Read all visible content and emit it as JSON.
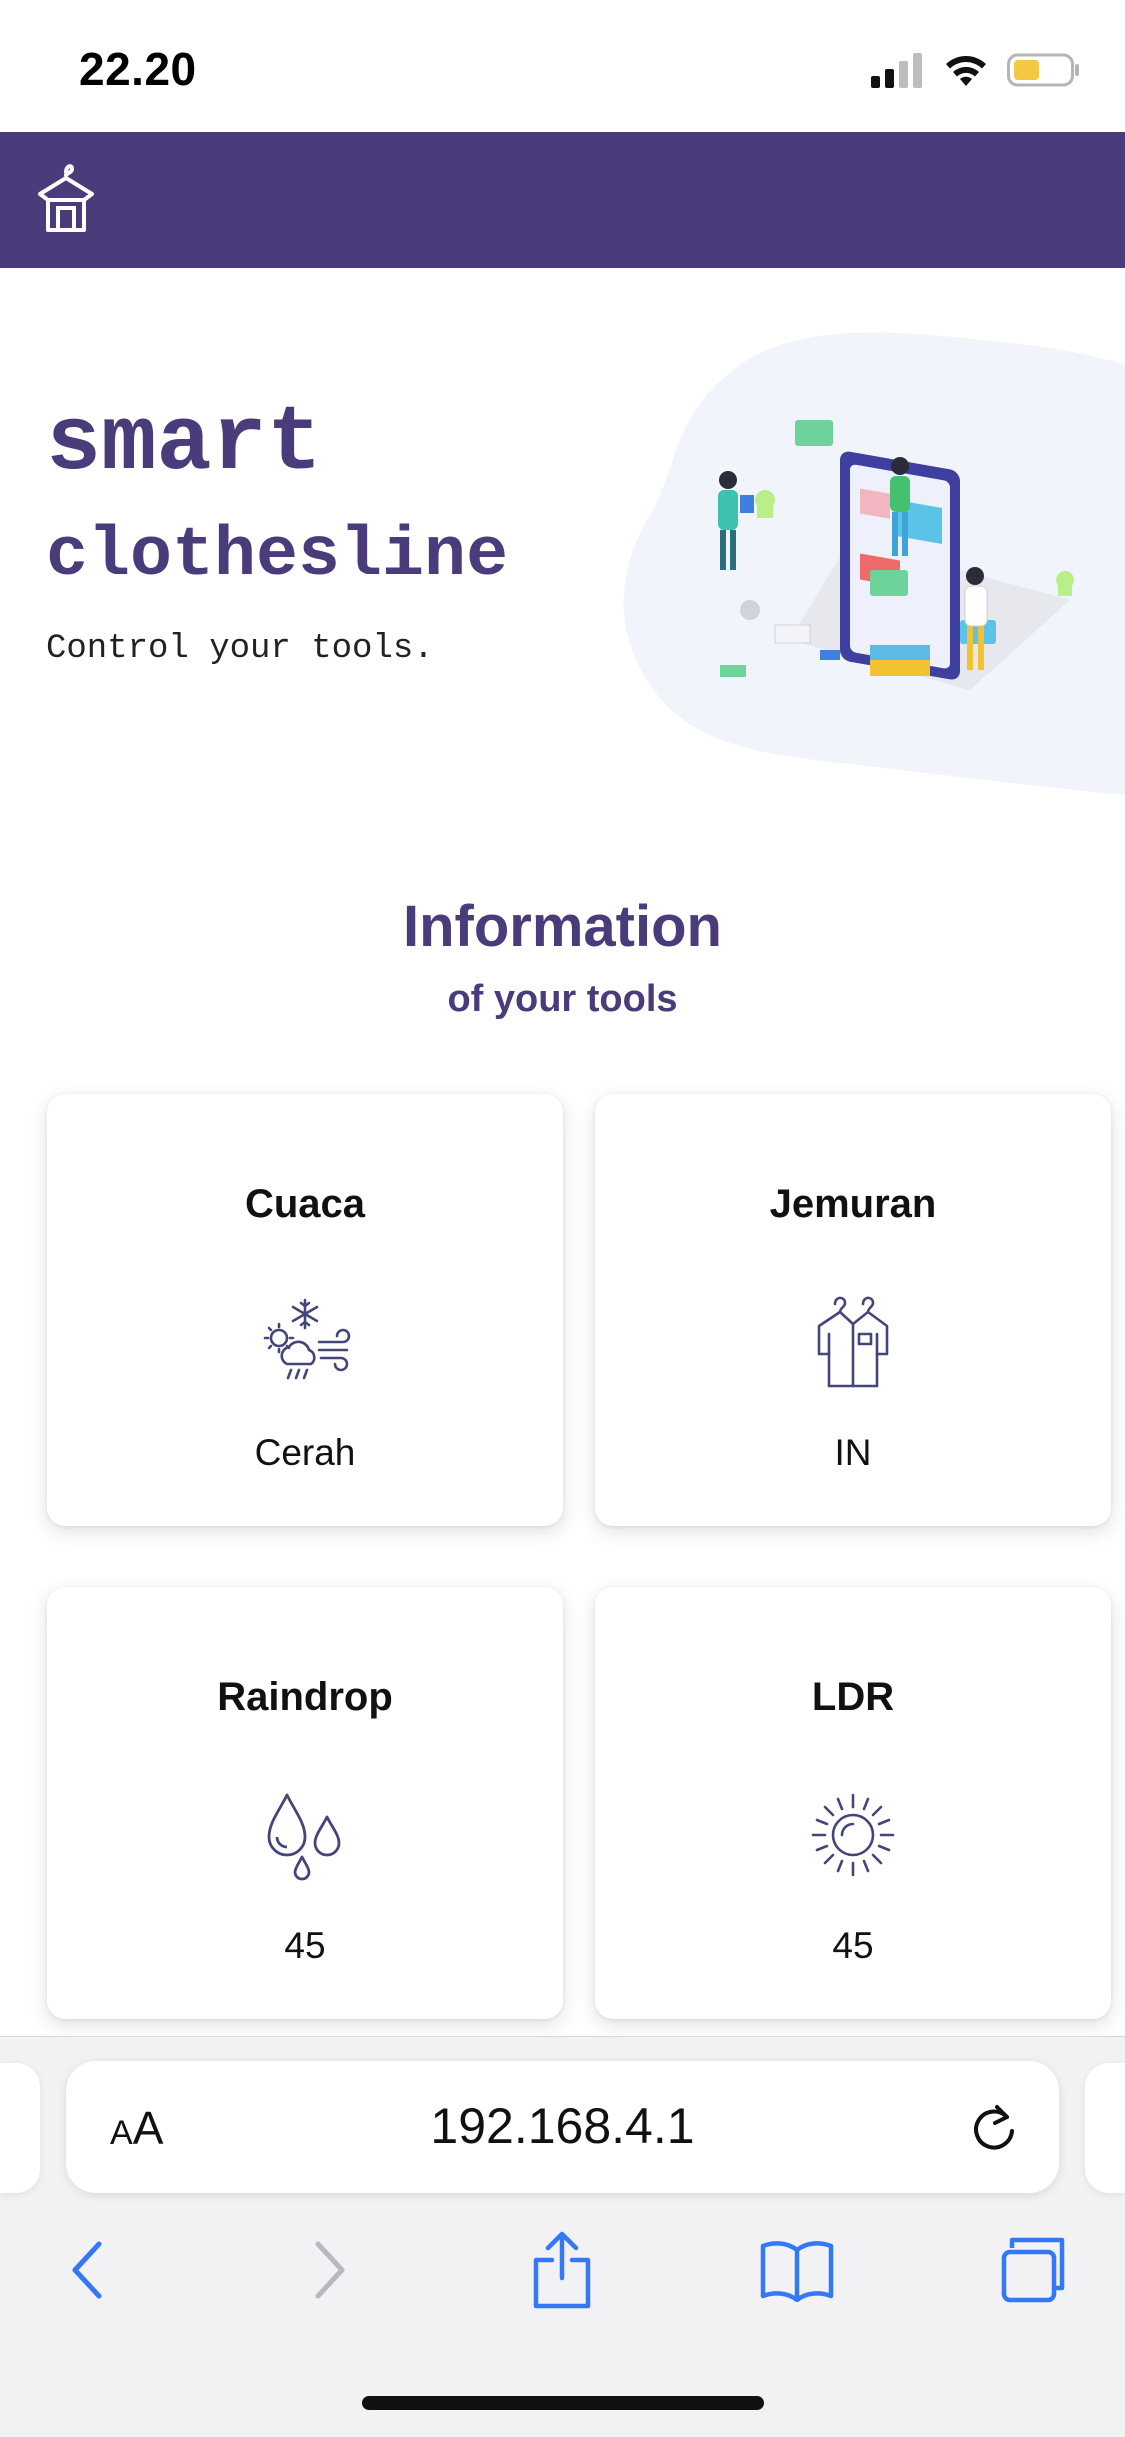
{
  "status_bar": {
    "time": "22.20"
  },
  "hero": {
    "title_line1": "smart",
    "title_line2": "clothesline",
    "subtitle": "Control your tools."
  },
  "section": {
    "title": "Information",
    "subtitle": "of your tools"
  },
  "cards": [
    {
      "title": "Cuaca",
      "icon": "weather-icon",
      "value": "Cerah"
    },
    {
      "title": "Jemuran",
      "icon": "clothes-hanger-icon",
      "value": "IN"
    },
    {
      "title": "Raindrop",
      "icon": "raindrop-icon",
      "value": "45"
    },
    {
      "title": "LDR",
      "icon": "sun-icon",
      "value": "45"
    }
  ],
  "browser": {
    "aa_label_small": "A",
    "aa_label_big": "A",
    "url": "192.168.4.1"
  },
  "colors": {
    "brand": "#4a3b7a",
    "ios_blue": "#3478f6",
    "battery": "#f5c842"
  }
}
